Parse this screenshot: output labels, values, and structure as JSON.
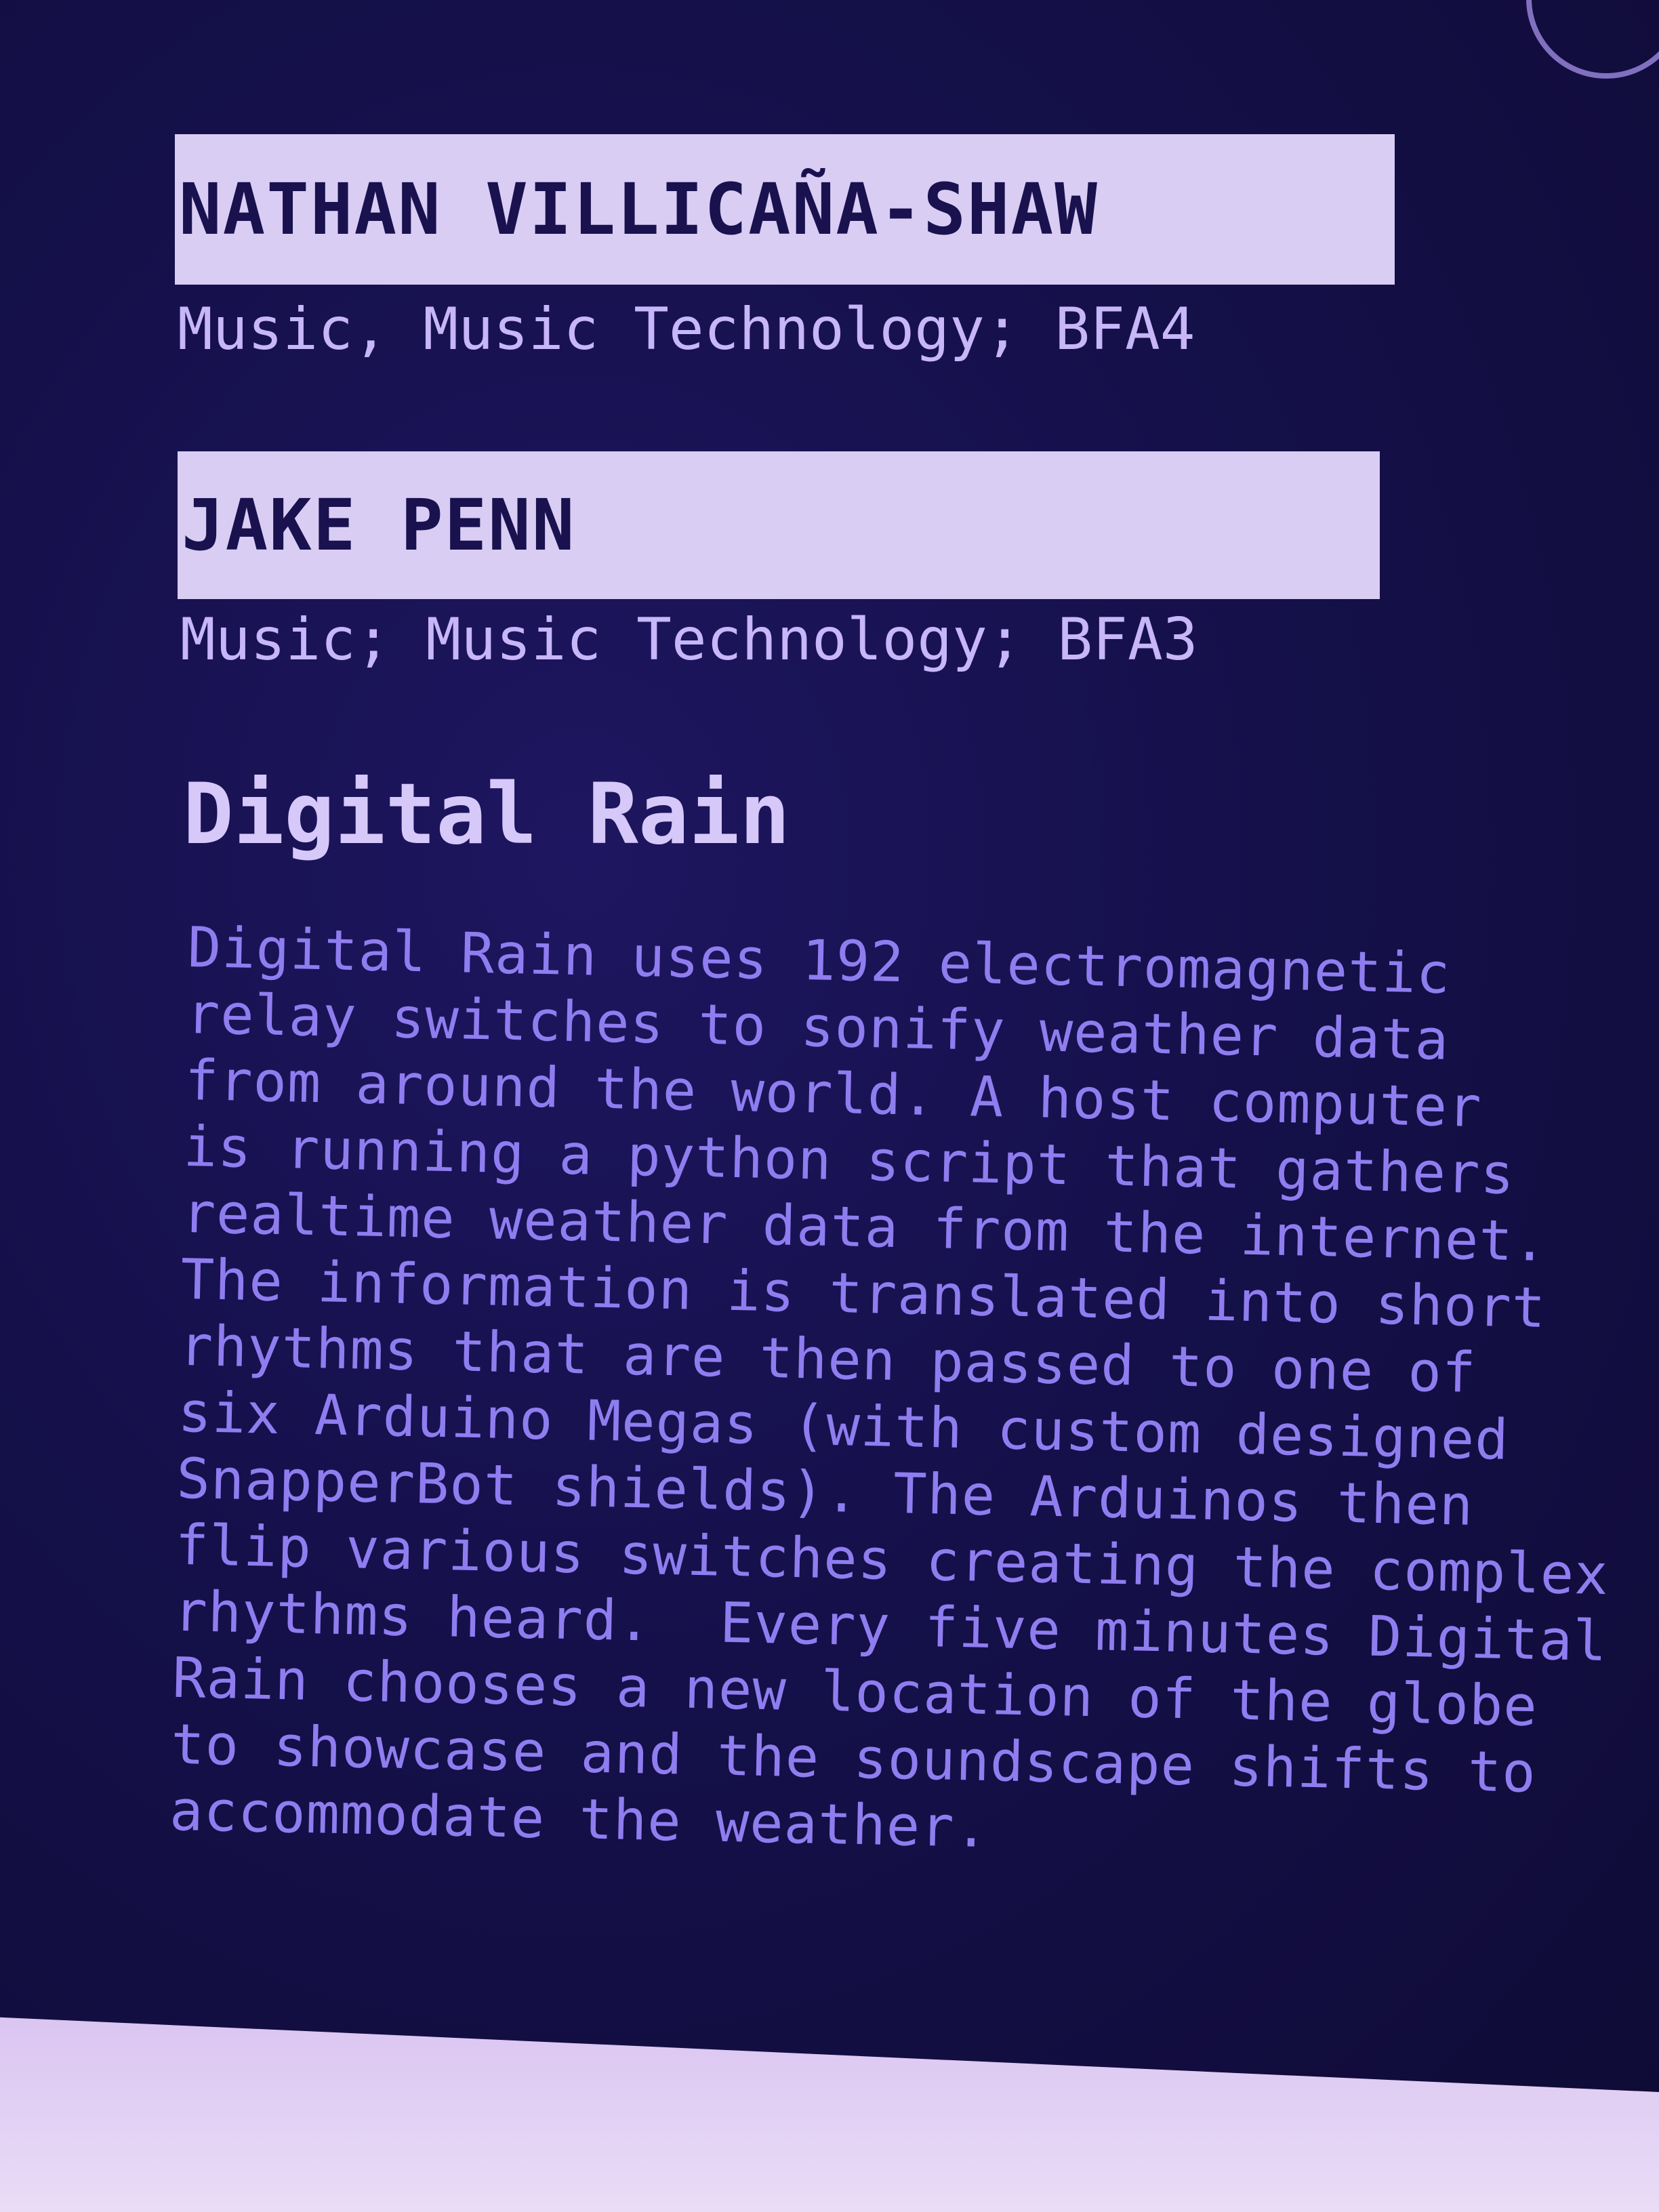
{
  "entries": [
    {
      "name": "NATHAN VILLICAÑA-SHAW",
      "program": "Music, Music Technology; BFA4"
    },
    {
      "name": "JAKE PENN",
      "program": "Music; Music Technology; BFA3"
    }
  ],
  "project": {
    "title": "Digital Rain",
    "description_lines": [
      "Digital Rain uses 192 electromagnetic",
      "relay switches to sonify weather data",
      "from around the world. A host computer",
      "is running a python script that gathers",
      "realtime weather data from the internet.",
      "The information is translated into short",
      "rhythms that are then passed to one of",
      "six Arduino Megas (with custom designed",
      "SnapperBot shields). The Arduinos then",
      "flip various switches creating the complex",
      "rhythms heard.  Every five minutes Digital",
      "Rain chooses a new location of the globe",
      "to showcase and the soundscape shifts to",
      "accommodate the weather."
    ]
  },
  "colors": {
    "placard": "#15104a",
    "name_bar": "#d9cdf4",
    "name_text": "#1a114f",
    "program_text": "#c7b6f8",
    "body_text": "#8f7df0"
  }
}
